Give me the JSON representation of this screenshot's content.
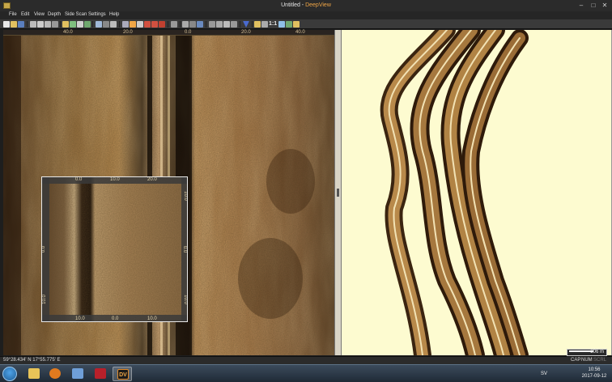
{
  "window": {
    "title_prefix": "Untitled - ",
    "title_brand": "DeepView",
    "minimize": "–",
    "maximize": "□",
    "close": "✕"
  },
  "menu": [
    "File",
    "Edit",
    "View",
    "Depth",
    "Side Scan",
    "Settings",
    "Help"
  ],
  "toolbar": {
    "text_buttons": {
      "one_to_one": "1:1"
    },
    "icons": [
      "new-icon",
      "open-icon",
      "save-icon",
      "cut-icon",
      "copy-icon",
      "paste-icon",
      "text-icon",
      "image-icon",
      "map-icon",
      "chart-icon",
      "measure-icon",
      "pan-icon",
      "pencil-icon",
      "anchor-icon",
      "select-icon",
      "undo-icon",
      "redo-icon",
      "stop-icon",
      "record-icon",
      "track-icon",
      "zoom-icon",
      "lock-icon",
      "waypoint-icon",
      "filter-icon",
      "grid-icon",
      "bars-icon",
      "one-to-one",
      "ruler-icon",
      "contrast-icon",
      "search-icon"
    ]
  },
  "sonar": {
    "ruler_ticks": [
      "40.0",
      "20.0",
      "0.0",
      "20.0",
      "40.0"
    ],
    "inset_ticks_top": [
      "0.0",
      "10.0",
      "20.0"
    ],
    "inset_ticks_bottom": [
      "10.0",
      "0.0",
      "10.0"
    ],
    "inset_ticks_right": [
      "10.0",
      "0.0",
      "10.0"
    ],
    "inset_ticks_left": [
      "0.0",
      "10.0"
    ]
  },
  "map": {
    "scale_label": "206 m"
  },
  "status": {
    "coordinates": "59°28.434' N  17°55.775' E",
    "cap": "CAP",
    "num": "NUM",
    "scrl": "SCRL"
  },
  "taskbar": {
    "apps": [
      "start-button",
      "explorer",
      "media-player",
      "paint",
      "antivirus",
      "deepview"
    ],
    "deepview_label": "DV",
    "lang": "SV",
    "time": "10:56",
    "date": "2017-09-12"
  },
  "colors": {
    "map_background": "#fdfbd0",
    "sonar_dark": "#2a1a0a",
    "sonar_light": "#c99a5a",
    "brand": "#f0a646"
  }
}
